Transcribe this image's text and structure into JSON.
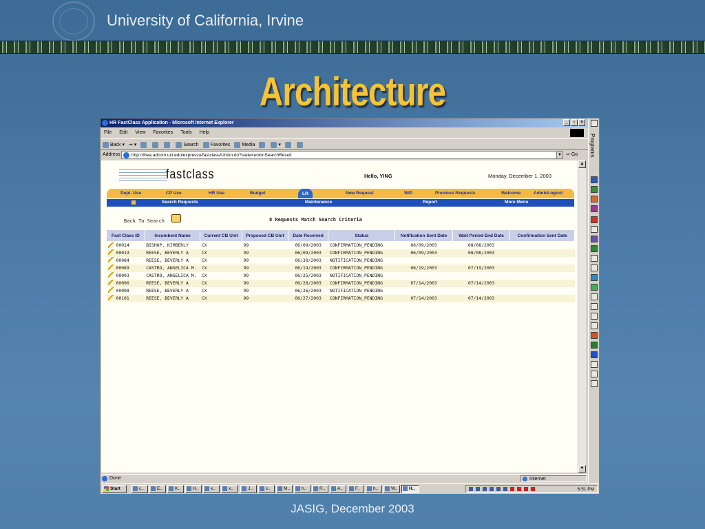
{
  "slide": {
    "header": "University of California, Irvine",
    "title": "Architecture",
    "footer": "JASIG, December 2003"
  },
  "window": {
    "title": "HR FastClass Application - Microsoft Internet Explorer",
    "menu": [
      "File",
      "Edit",
      "View",
      "Favorites",
      "Tools",
      "Help"
    ],
    "toolbar": [
      "Back",
      "Search",
      "Favorites",
      "Media"
    ],
    "address_label": "Address",
    "url": "http://thea.adcom.uci.edu/expresso/fastclass/Union.do?state=unionSearchResult",
    "go_label": "Go",
    "side_panel_label": "Programs",
    "status_text": "Done",
    "zone": "Internet"
  },
  "page": {
    "logo": "fastclass",
    "greeting": "Hello, YING",
    "date": "Monday, December 1, 2003",
    "nav_primary": [
      "Dept. Use",
      "CP Use",
      "HR Use",
      "Budget",
      "LR",
      "New Request",
      "WIP",
      "Previous Requests",
      "Welcome",
      "AdminLogout"
    ],
    "nav_active": "LR",
    "nav_secondary": [
      "Search Requests",
      "Maintenance",
      "Report",
      "More Menu"
    ],
    "back_label": "Back To Search",
    "match_text": "8 Requests Match Search Criteria",
    "columns": [
      "Fast Class ID",
      "Incumbent Name",
      "Current CB Unit",
      "Proposed CB Unit",
      "Date Received",
      "Status",
      "Notification Sent Date",
      "Wait Period End Date",
      "Confirmation Sent Date"
    ],
    "rows": [
      [
        "00014",
        "BISHOP, KIMBERLY",
        "CX",
        "99",
        "06/09/2003",
        "CONFIRMATION_PENDING",
        "06/09/2003",
        "08/08/2003",
        ""
      ],
      [
        "00019",
        "REESE, BEVERLY A",
        "CX",
        "99",
        "06/09/2003",
        "CONFIRMATION_PENDING",
        "06/09/2003",
        "08/08/2003",
        ""
      ],
      [
        "00084",
        "REESE, BEVERLY A",
        "CX",
        "99",
        "06/30/2003",
        "NOTIFICATION_PENDING",
        "",
        "",
        ""
      ],
      [
        "00089",
        "CASTRO, ANGELICA M.",
        "CX",
        "99",
        "06/19/2003",
        "CONFIRMATION_PENDING",
        "06/19/2003",
        "07/19/2003",
        ""
      ],
      [
        "00093",
        "CASTRO, ANGELICA M.",
        "CX",
        "99",
        "06/25/2003",
        "NOTIFICATION_PENDING",
        "",
        "",
        ""
      ],
      [
        "00096",
        "REESE, BEVERLY A",
        "CX",
        "99",
        "06/26/2003",
        "CONFIRMATION_PENDING",
        "07/14/2003",
        "07/14/2003",
        ""
      ],
      [
        "00098",
        "REESE, BEVERLY A",
        "CX",
        "99",
        "06/26/2003",
        "NOTIFICATION_PENDING",
        "",
        "",
        ""
      ],
      [
        "00101",
        "REESE, BEVERLY A",
        "CX",
        "99",
        "06/27/2003",
        "CONFIRMATION_PENDING",
        "07/14/2003",
        "07/14/2003",
        ""
      ]
    ]
  },
  "taskbar": {
    "start": "Start",
    "buttons": [
      "c..",
      "E..",
      "K..",
      "H..",
      "x..",
      "x..",
      "J...",
      "x..",
      "M..",
      "h..",
      "R..",
      "A..",
      "F..",
      "h..",
      "W..",
      "H.."
    ],
    "clock": "6:51 PM"
  },
  "colors": {
    "slide_title": "#f6c333",
    "nav_primary_bg": "#f5b946",
    "nav_secondary_bg": "#1f4fbc",
    "table_header_bg": "#c9cfe9"
  }
}
